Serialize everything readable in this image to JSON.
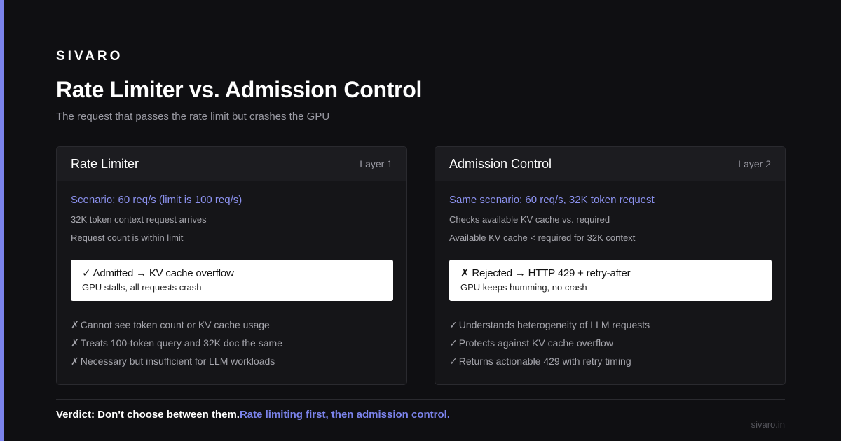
{
  "brand": "SIVARO",
  "title": "Rate Limiter vs. Admission Control",
  "subtitle": "The request that passes the rate limit but crashes the GPU",
  "colors": {
    "accent": "#7b83eb",
    "background": "#0f0f12",
    "card": "#151518"
  },
  "cards": [
    {
      "title": "Rate Limiter",
      "layer": "Layer 1",
      "scenario": "Scenario: 60 req/s (limit is 100 req/s)",
      "lines": [
        "32K token context request arrives",
        "Request count is within limit"
      ],
      "result_title": "✓ Admitted → KV cache overflow",
      "result_sub": "GPU stalls, all requests crash",
      "points": [
        {
          "mark": "✗",
          "text": "Cannot see token count or KV cache usage"
        },
        {
          "mark": "✗",
          "text": "Treats 100-token query and 32K doc the same"
        },
        {
          "mark": "✗",
          "text": "Necessary but insufficient for LLM workloads"
        }
      ]
    },
    {
      "title": "Admission Control",
      "layer": "Layer 2",
      "scenario": "Same scenario: 60 req/s, 32K token request",
      "lines": [
        "Checks available KV cache vs. required",
        "Available KV cache < required for 32K context"
      ],
      "result_title": "✗ Rejected → HTTP 429 + retry-after",
      "result_sub": "GPU keeps humming, no crash",
      "points": [
        {
          "mark": "✓",
          "text": "Understands heterogeneity of LLM requests"
        },
        {
          "mark": "✓",
          "text": "Protects against KV cache overflow"
        },
        {
          "mark": "✓",
          "text": "Returns actionable 429 with retry timing"
        }
      ]
    }
  ],
  "verdict": {
    "label": "Verdict: Don't choose between them.",
    "highlight": "Rate limiting first, then admission control."
  },
  "footer_url": "sivaro.in"
}
